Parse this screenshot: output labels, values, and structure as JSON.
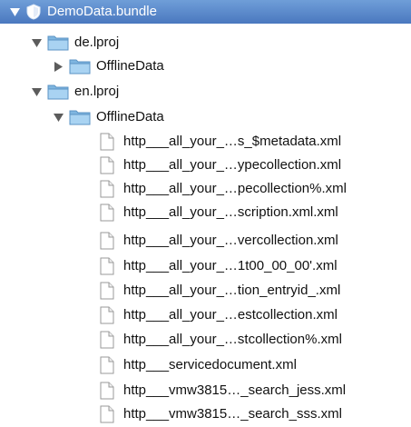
{
  "tree": {
    "root": {
      "label": "DemoData.bundle",
      "icon": "bundle-icon",
      "expanded": true,
      "selected": true
    },
    "items": [
      {
        "label": "de.lproj",
        "icon": "folder-icon",
        "expanded": true
      },
      {
        "label": "OfflineData",
        "icon": "folder-icon",
        "expanded": false
      },
      {
        "label": "en.lproj",
        "icon": "folder-icon",
        "expanded": true
      },
      {
        "label": "OfflineData",
        "icon": "folder-icon",
        "expanded": true
      },
      {
        "label": "http___all_your_…s_$metadata.xml",
        "icon": "document-icon"
      },
      {
        "label": "http___all_your_…ypecollection.xml",
        "icon": "document-icon"
      },
      {
        "label": "http___all_your_…pecollection%.xml",
        "icon": "document-icon"
      },
      {
        "label": "http___all_your_…scription.xml.xml",
        "icon": "document-icon"
      },
      {
        "label": "http___all_your_…vercollection.xml",
        "icon": "document-icon"
      },
      {
        "label": "http___all_your_…1t00_00_00'.xml",
        "icon": "document-icon"
      },
      {
        "label": "http___all_your_…tion_entryid_.xml",
        "icon": "document-icon"
      },
      {
        "label": "http___all_your_…estcollection.xml",
        "icon": "document-icon"
      },
      {
        "label": "http___all_your_…stcollection%.xml",
        "icon": "document-icon"
      },
      {
        "label": "http___servicedocument.xml",
        "icon": "document-icon"
      },
      {
        "label": "http___vmw3815…_search_jess.xml",
        "icon": "document-icon"
      },
      {
        "label": "http___vmw3815…_search_sss.xml",
        "icon": "document-icon"
      }
    ]
  },
  "colors": {
    "selection": "#5a86c8",
    "folder": "#8fc3ea",
    "disclosure": "#5c5c5c"
  }
}
